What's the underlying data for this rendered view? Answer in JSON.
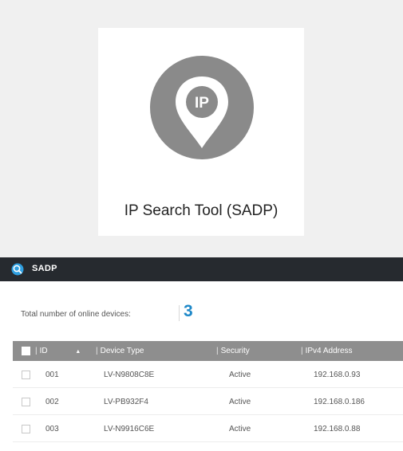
{
  "tile": {
    "title": "IP Search Tool (SADP)",
    "icon": "ip-location-pin-icon",
    "logo_text": "IP"
  },
  "window": {
    "title": "SADP",
    "logo_icon": "sadp-logo-icon"
  },
  "summary": {
    "label": "Total number of online devices:",
    "count": "3"
  },
  "table": {
    "columns": [
      {
        "label": "ID",
        "sort_icon": "sort-up-arrow-icon",
        "sort_glyph": "▲"
      },
      {
        "label": "Device Type"
      },
      {
        "label": "Security"
      },
      {
        "label": "IPv4 Address"
      }
    ],
    "rows": [
      {
        "id": "001",
        "device_type": "LV-N9808C8E",
        "security": "Active",
        "ipv4": "192.168.0.93"
      },
      {
        "id": "002",
        "device_type": "LV-PB932F4",
        "security": "Active",
        "ipv4": "192.168.0.186"
      },
      {
        "id": "003",
        "device_type": "LV-N9916C6E",
        "security": "Active",
        "ipv4": "192.168.0.88"
      }
    ]
  },
  "colors": {
    "title_bar": "#262a2f",
    "accent": "#1e88c8",
    "header_bg": "#8e8e8e",
    "logo_gray": "#8a8a8a"
  }
}
